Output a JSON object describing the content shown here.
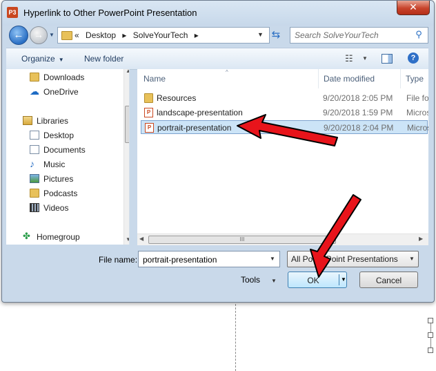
{
  "window": {
    "title": "Hyperlink to Other PowerPoint Presentation",
    "app_icon_text": "P3",
    "close_glyph": "✕"
  },
  "navigation": {
    "back_glyph": "←",
    "forward_glyph": "→",
    "breadcrumb_prefix": "«",
    "breadcrumb": [
      "Desktop",
      "SolveYourTech"
    ],
    "breadcrumb_separator": "▸",
    "search_placeholder": "Search SolveYourTech"
  },
  "toolbar": {
    "organize_label": "Organize",
    "new_folder_label": "New folder",
    "help_glyph": "?"
  },
  "sidebar": {
    "items": [
      {
        "label": "Downloads",
        "icon": "folder-icon"
      },
      {
        "label": "OneDrive",
        "icon": "cloud-icon"
      },
      {
        "label": "Libraries",
        "icon": "library-icon"
      },
      {
        "label": "Desktop",
        "icon": "desktop-icon"
      },
      {
        "label": "Documents",
        "icon": "documents-icon"
      },
      {
        "label": "Music",
        "icon": "music-icon"
      },
      {
        "label": "Pictures",
        "icon": "pictures-icon"
      },
      {
        "label": "Podcasts",
        "icon": "podcasts-icon"
      },
      {
        "label": "Videos",
        "icon": "videos-icon"
      },
      {
        "label": "Homegroup",
        "icon": "homegroup-icon"
      }
    ]
  },
  "file_list": {
    "columns": [
      "Name",
      "Date modified",
      "Type"
    ],
    "rows": [
      {
        "name": "Resources",
        "date": "9/20/2018 2:05 PM",
        "type": "File fol",
        "icon": "folder-icon",
        "selected": false
      },
      {
        "name": "landscape-presentation",
        "date": "9/20/2018 1:59 PM",
        "type": "Micros",
        "icon": "powerpoint-file-icon",
        "selected": false
      },
      {
        "name": "portrait-presentation",
        "date": "9/20/2018 2:04 PM",
        "type": "Micros",
        "icon": "powerpoint-file-icon",
        "selected": true
      }
    ],
    "scroll_grip": "III"
  },
  "footer": {
    "file_name_label": "File name:",
    "file_name_value": "portrait-presentation",
    "file_type_value": "All PowerPoint Presentations",
    "tools_label": "Tools",
    "ok_label": "OK",
    "cancel_label": "Cancel"
  },
  "colors": {
    "annotation_arrow": "#e8141b",
    "selection_bg": "#cce4f7",
    "window_frame": "#c9d9ea"
  }
}
